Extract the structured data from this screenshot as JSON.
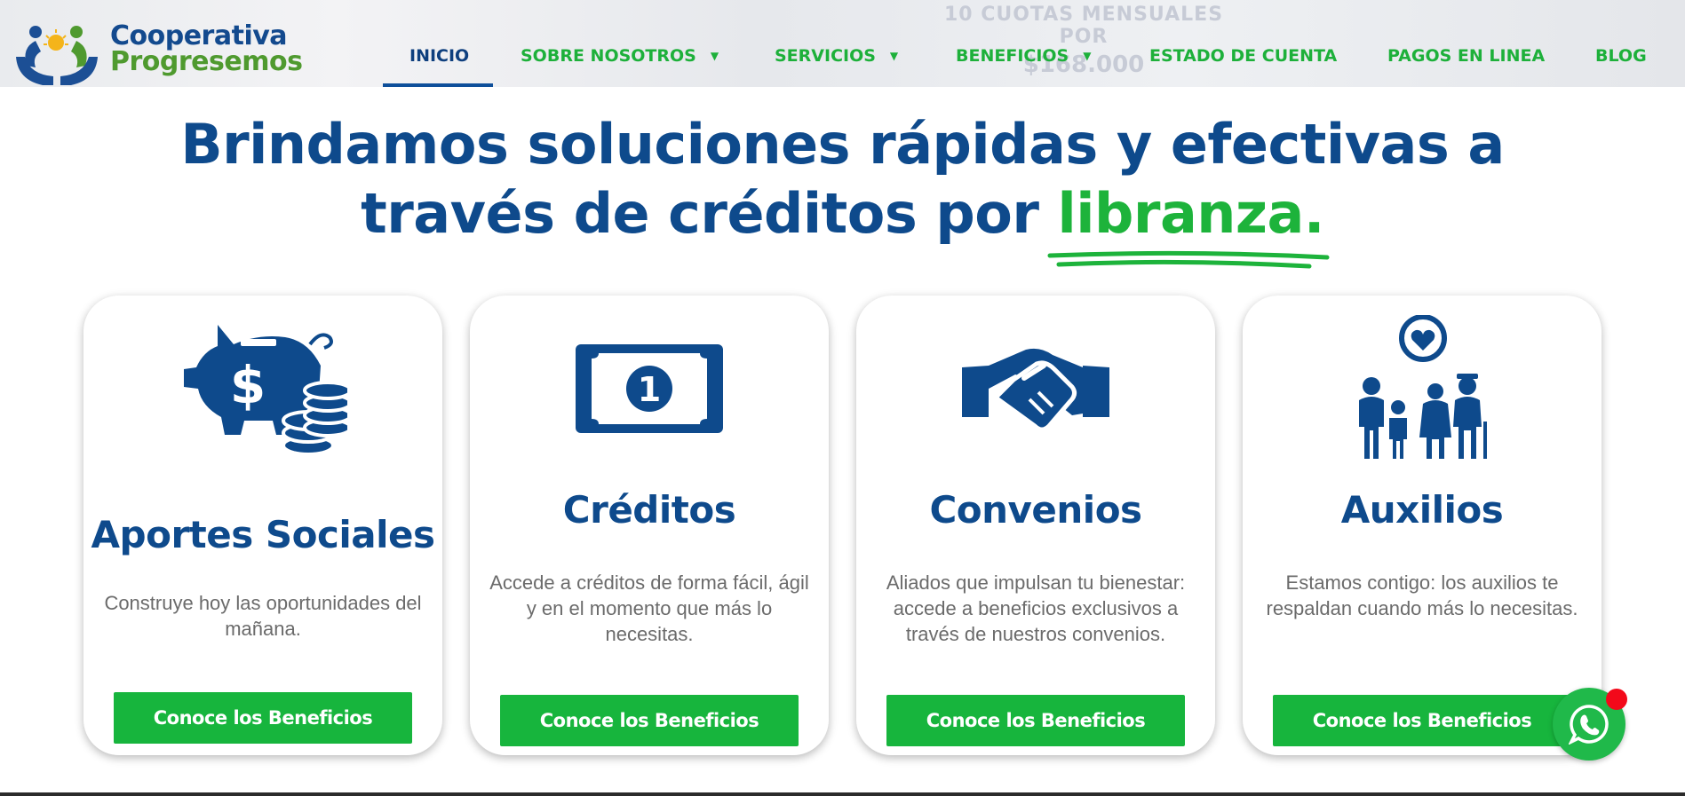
{
  "header": {
    "logo": {
      "line1": "Cooperativa",
      "line2": "Progresemos"
    },
    "hero_text": {
      "line1": "10 CUOTAS MENSUALES POR",
      "line2": "$168.000"
    },
    "nav": [
      {
        "label": "INICIO",
        "active": true
      },
      {
        "label": "SOBRE NOSOTROS",
        "dropdown": true
      },
      {
        "label": "SERVICIOS",
        "dropdown": true
      },
      {
        "label": "BENEFICIOS",
        "dropdown": true
      },
      {
        "label": "ESTADO DE CUENTA"
      },
      {
        "label": "PAGOS EN LINEA"
      },
      {
        "label": "BLOG"
      }
    ],
    "caret_glyph": "▼"
  },
  "headline": {
    "line1": "Brindamos soluciones rápidas y efectivas a",
    "line2_prefix": "través de créditos por ",
    "line2_highlight": "libranza."
  },
  "cards": [
    {
      "icon": "piggy-bank-icon",
      "title": "Aportes Sociales",
      "text": "Construye hoy las oportunidades del mañana.",
      "button": "Conoce los Beneficios"
    },
    {
      "icon": "banknote-icon",
      "title": "Créditos",
      "text": "Accede a créditos de forma fácil, ágil y en el momento que más lo necesitas.",
      "button": "Conoce los Beneficios"
    },
    {
      "icon": "handshake-icon",
      "title": "Convenios",
      "text": "Aliados que impulsan tu bienestar: accede a beneficios exclusivos a través de nuestros convenios.",
      "button": "Conoce los Beneficios"
    },
    {
      "icon": "family-heart-icon",
      "title": "Auxilios",
      "text": "Estamos contigo: los auxilios te respaldan cuando más lo necesitas.",
      "button": "Conoce los Beneficios"
    }
  ],
  "widgets": {
    "whatsapp_icon": "whatsapp-icon",
    "notification_icon": "notification-dot"
  },
  "colors": {
    "navy": "#0e4a8c",
    "green": "#17b53d",
    "nav_green": "#1db03a",
    "gray_text": "#6b6b6b",
    "red_dot": "#f3091a"
  }
}
